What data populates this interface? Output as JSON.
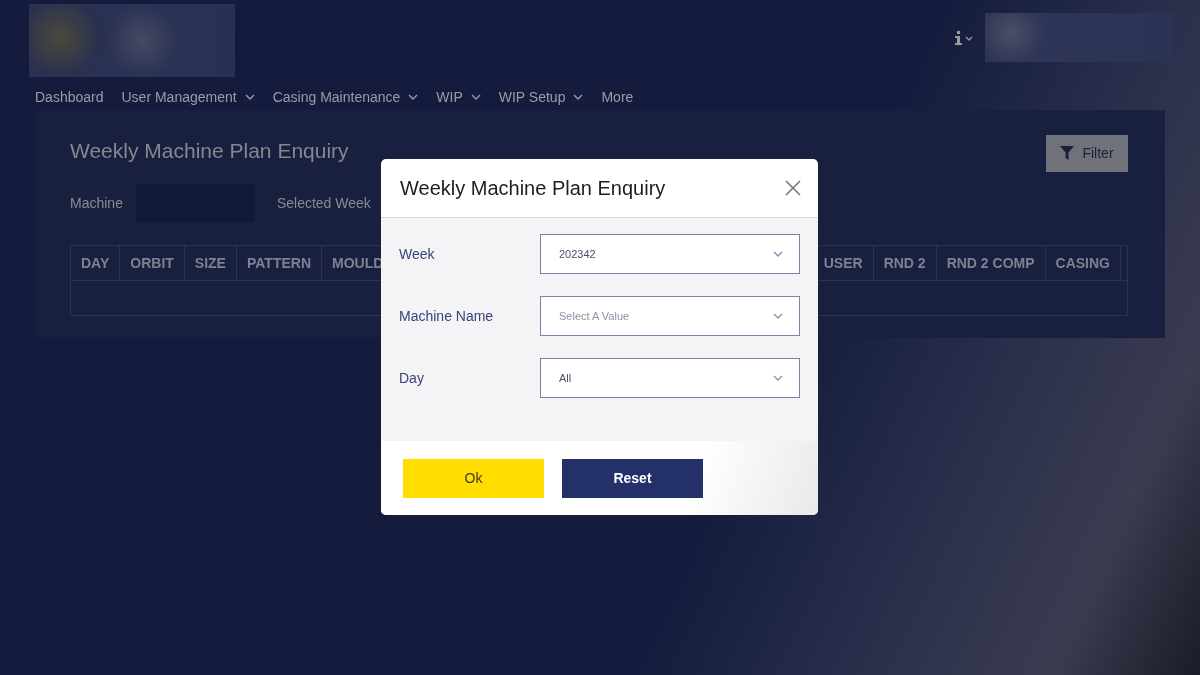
{
  "header": {
    "nav": [
      {
        "label": "Dashboard",
        "dropdown": false
      },
      {
        "label": "User Management",
        "dropdown": true
      },
      {
        "label": "Casing Maintenance",
        "dropdown": true
      },
      {
        "label": "WIP",
        "dropdown": true
      },
      {
        "label": "WIP Setup",
        "dropdown": true
      },
      {
        "label": "More",
        "dropdown": false
      }
    ]
  },
  "page": {
    "title": "Weekly Machine Plan Enquiry",
    "filter_button": "Filter",
    "machine_label": "Machine",
    "selected_week_label": "Selected Week",
    "table": {
      "columns_left": [
        "DAY",
        "ORBIT",
        "SIZE",
        "PATTERN",
        "MOULD"
      ],
      "columns_right": [
        "USER",
        "RND 2",
        "RND 2 COMP",
        "CASING"
      ]
    }
  },
  "modal": {
    "title": "Weekly Machine Plan Enquiry",
    "fields": [
      {
        "label": "Week",
        "value": "202342"
      },
      {
        "label": "Machine Name",
        "placeholder": "Select A Value"
      },
      {
        "label": "Day",
        "value": "All"
      }
    ],
    "buttons": [
      {
        "label": "Ok",
        "kind": "primary"
      },
      {
        "label": "Reset",
        "kind": "secondary"
      }
    ]
  }
}
